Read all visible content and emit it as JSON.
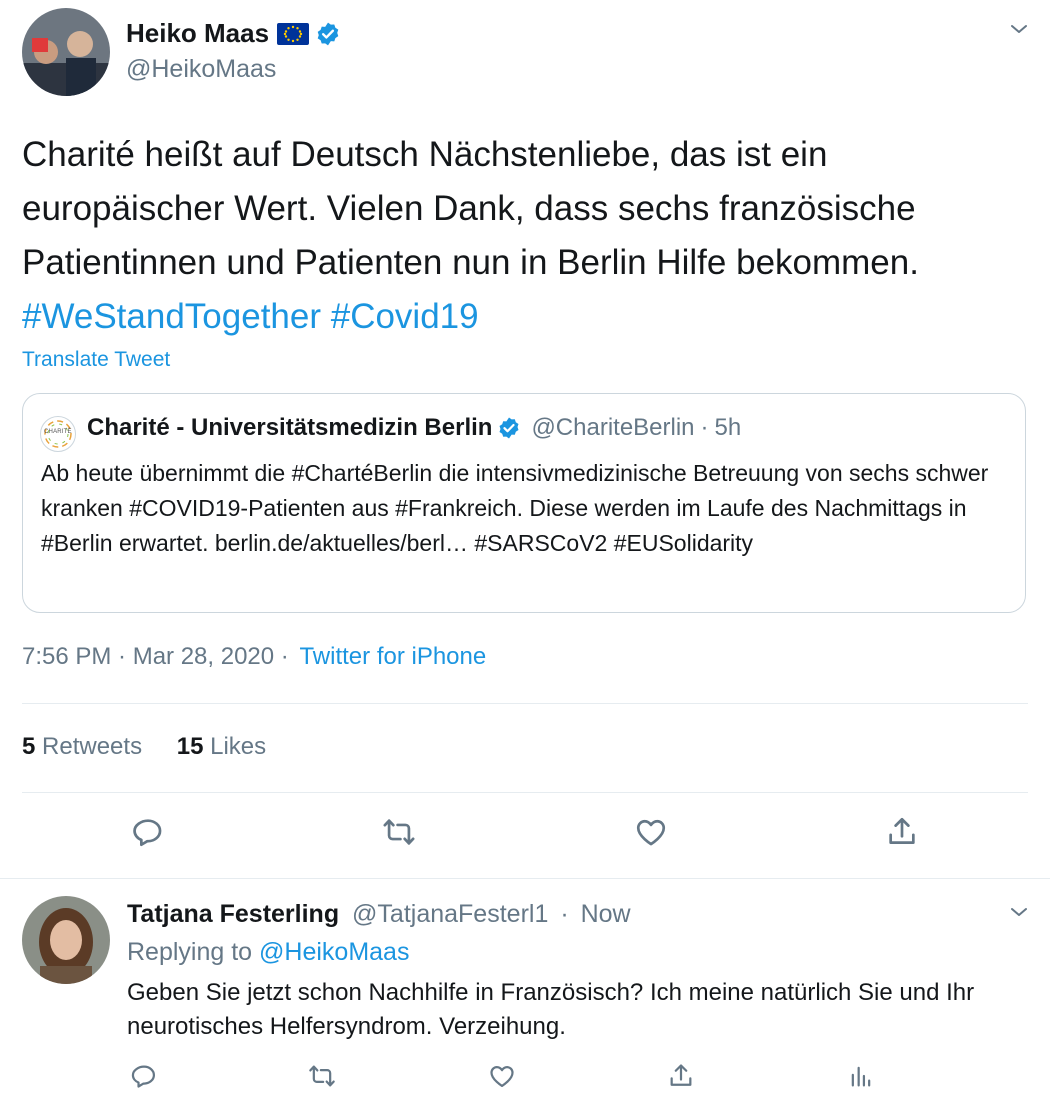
{
  "tweet": {
    "author": {
      "name": "Heiko Maas",
      "handle": "@HeikoMaas",
      "flag_icon": "eu-flag-icon",
      "verified_icon": "verified-badge-icon"
    },
    "text": "Charité heißt auf Deutsch Nächstenliebe, das ist ein europäischer Wert. Vielen Dank, dass sechs französische Patientinnen und Patienten nun in Berlin Hilfe bekommen.",
    "hashtags": "#WeStandTogether #Covid19",
    "translate_label": "Translate Tweet",
    "quote": {
      "logo_text": "CHARITÉ",
      "name": "Charité - Universitätsmedizin Berlin",
      "handle": "@ChariteBerlin",
      "separator": "·",
      "time": "5h",
      "text": "Ab heute übernimmt die #ChartéBerlin die intensivmedizinische Betreuung von sechs schwer kranken #COVID19-Patienten aus #Frankreich. Diese werden im Laufe des Nachmittags in #Berlin erwartet. berlin.de/aktuelles/berl… #SARSCoV2 #EUSolidarity"
    },
    "timestamp": "7:56 PM · Mar 28, 2020 ·",
    "source": "Twitter for iPhone",
    "retweets_count": "5",
    "retweets_label": "Retweets",
    "likes_count": "15",
    "likes_label": "Likes",
    "actions": [
      "reply-icon",
      "retweet-icon",
      "like-icon",
      "share-icon"
    ]
  },
  "reply": {
    "name": "Tatjana Festerling",
    "handle": "@TatjanaFesterl1",
    "separator": "·",
    "time": "Now",
    "replying_prefix": "Replying to",
    "replying_to": "@HeikoMaas",
    "text": "Geben Sie jetzt schon Nachhilfe in Französisch? Ich meine natürlich Sie und Ihr neurotisches Helfersyndrom. Verzeihung.",
    "actions": [
      "reply-icon",
      "retweet-icon",
      "like-icon",
      "share-icon",
      "analytics-icon"
    ]
  },
  "colors": {
    "link": "#1b95e0",
    "secondary_text": "#657786",
    "primary_text": "#14171a",
    "divider": "#e6ecf0",
    "eu_blue": "#003399",
    "eu_star": "#ffcc00"
  }
}
